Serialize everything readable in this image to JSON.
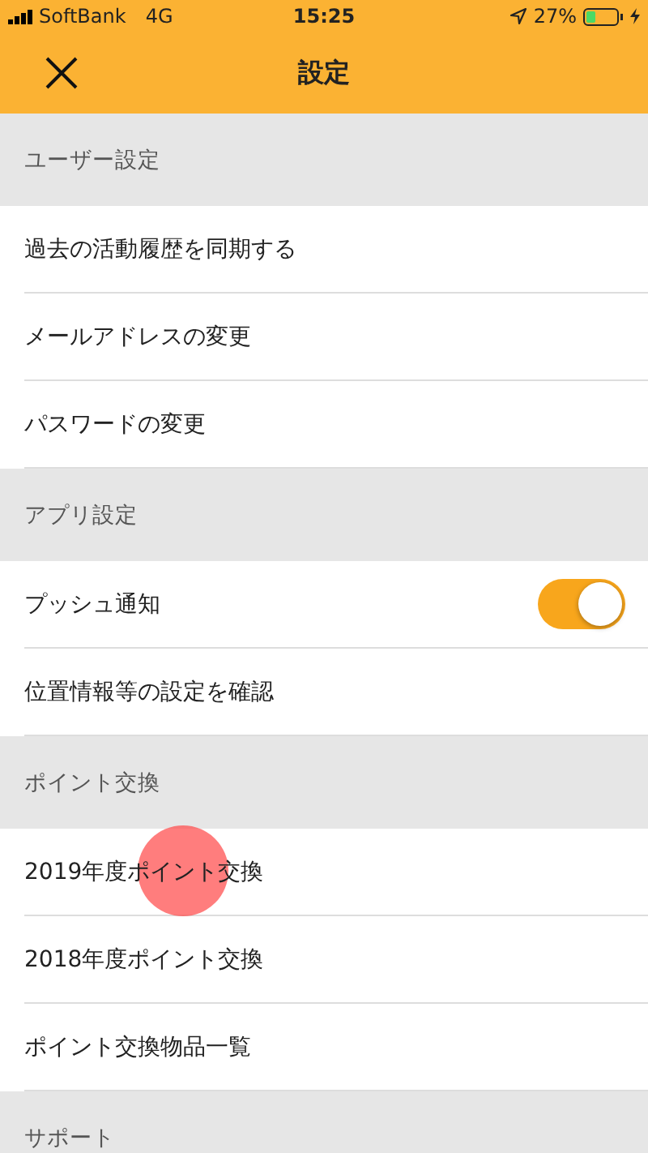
{
  "status_bar": {
    "carrier": "SoftBank",
    "network": "4G",
    "time": "15:25",
    "battery": "27%"
  },
  "header": {
    "title": "設定"
  },
  "sections": [
    {
      "title": "ユーザー設定",
      "items": [
        {
          "label": "過去の活動履歴を同期する",
          "kind": "link"
        },
        {
          "label": "メールアドレスの変更",
          "kind": "link"
        },
        {
          "label": "パスワードの変更",
          "kind": "link"
        }
      ]
    },
    {
      "title": "アプリ設定",
      "items": [
        {
          "label": "プッシュ通知",
          "kind": "toggle",
          "on": true
        },
        {
          "label": "位置情報等の設定を確認",
          "kind": "link"
        }
      ]
    },
    {
      "title": "ポイント交換",
      "items": [
        {
          "label": "2019年度ポイント交換",
          "kind": "link"
        },
        {
          "label": "2018年度ポイント交換",
          "kind": "link"
        },
        {
          "label": "ポイント交換物品一覧",
          "kind": "link"
        }
      ]
    },
    {
      "title": "サポート"
    }
  ]
}
